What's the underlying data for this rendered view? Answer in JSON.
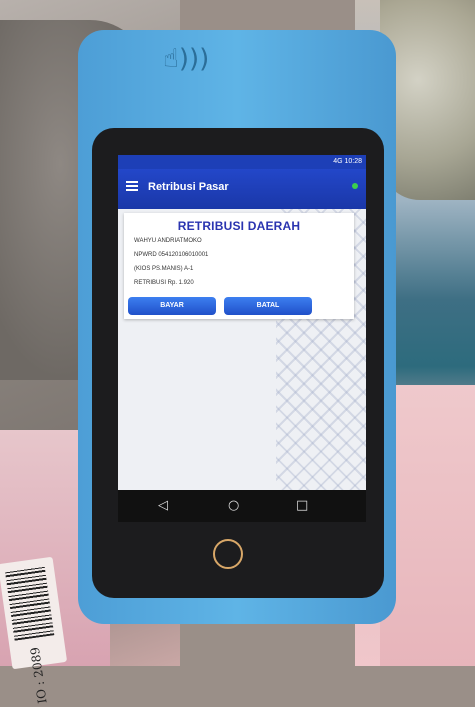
{
  "status": {
    "text": "4G 10:28"
  },
  "app": {
    "title": "Retribusi Pasar"
  },
  "card": {
    "title": "RETRIBUSI DAERAH",
    "name": "WAHYU ANDRIATMOKO",
    "npwrd": "NPWRD 054120106010001",
    "kios": "(KIOS PS.MANIS)  A-1",
    "retribusi": "RETRIBUSI Rp. 1.920"
  },
  "buttons": {
    "bayar": "BAYAR",
    "batal": "BATAL"
  },
  "nav": {
    "back": "◁",
    "home": "○",
    "recent": "□"
  },
  "background": {
    "barcode_text": "IO : 2089"
  },
  "colors": {
    "appbar": "#1f3fbf",
    "button": "#2f66e0",
    "title_text": "#2a34b0",
    "device": "#55a9df"
  },
  "icons": {
    "menu": "hamburger-icon",
    "status_dot": "status-dot-icon",
    "nfc": "nfc-icon"
  }
}
